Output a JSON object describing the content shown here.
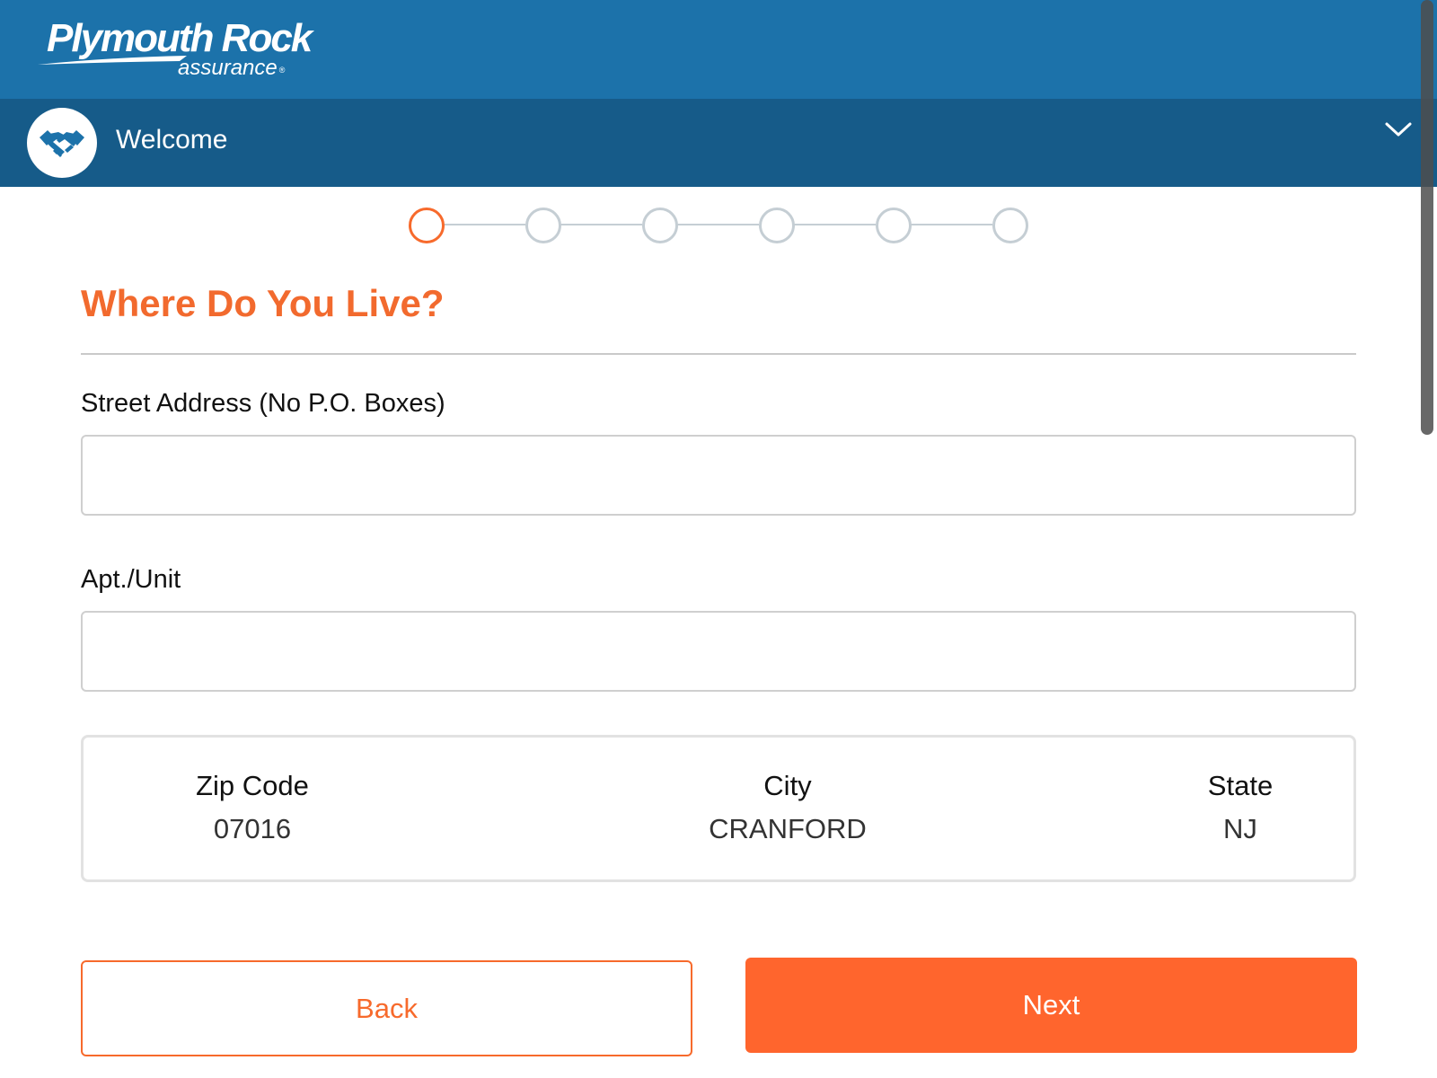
{
  "brand": {
    "logo_main": "Plymouth Rock",
    "logo_sub": "assurance",
    "logo_reg": "®",
    "bar_color": "#1c72aa"
  },
  "section": {
    "icon": "handshake-icon",
    "title": "Welcome",
    "toggle_icon": "chevron-down-icon",
    "bar_color": "#165b89"
  },
  "stepper": {
    "total_steps": 6,
    "current_step": 1,
    "active_color": "#f76a2c",
    "inactive_color": "#c5ced4"
  },
  "form": {
    "heading": "Where Do You Live?",
    "street_label": "Street Address (No P.O. Boxes)",
    "street_value": "",
    "apt_label": "Apt./Unit",
    "apt_value": ""
  },
  "location": {
    "zip_label": "Zip Code",
    "zip_value": "07016",
    "city_label": "City",
    "city_value": "CRANFORD",
    "state_label": "State",
    "state_value": "NJ"
  },
  "actions": {
    "back_label": "Back",
    "next_label": "Next",
    "accent_color": "#ff652d"
  }
}
